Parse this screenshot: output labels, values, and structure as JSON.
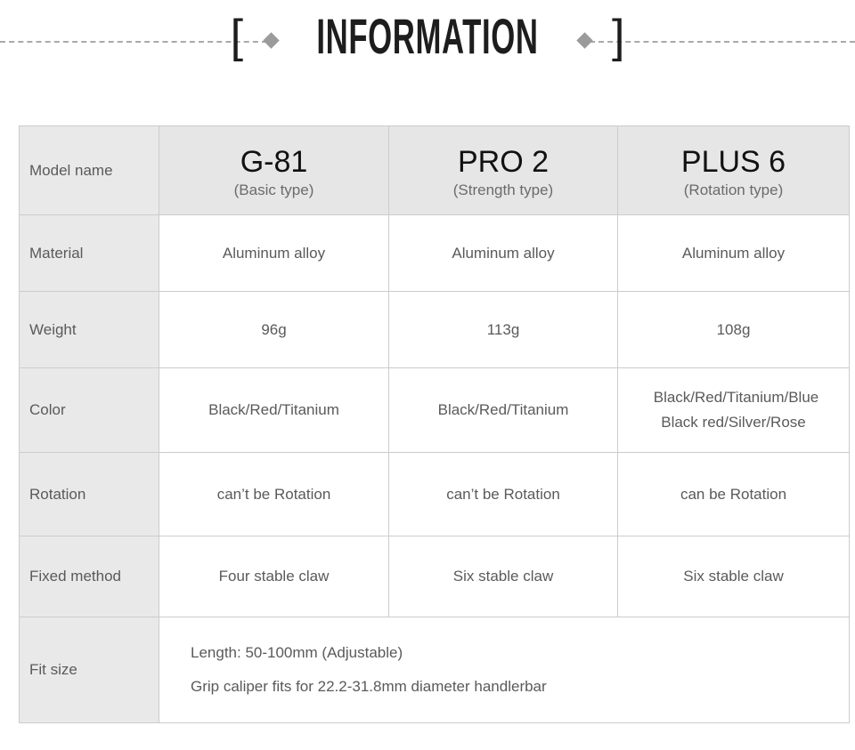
{
  "banner": {
    "bracket_left": "[",
    "title": "INFORMATION",
    "bracket_right": "]",
    "accent_color": "#9b9b9b",
    "rule_color": "#a9a9a9",
    "title_color": "#1d1d1d"
  },
  "table": {
    "header_bg": "#e6e6e6",
    "label_bg": "#e9e9e9",
    "border_color": "#cccccc",
    "columns": [
      {
        "label": "Model name",
        "model": "G-81",
        "type": "(Basic type)"
      },
      {
        "label": "Model name",
        "model": "PRO 2",
        "type": "(Strength type)"
      },
      {
        "label": "Model name",
        "model": "PLUS 6",
        "type": "(Rotation type)"
      }
    ],
    "header_label": "Model name",
    "rows": [
      {
        "label": "Material",
        "values": [
          "Aluminum alloy",
          "Aluminum alloy",
          "Aluminum alloy"
        ]
      },
      {
        "label": "Weight",
        "values": [
          "96g",
          "113g",
          "108g"
        ]
      },
      {
        "label": "Color",
        "values": [
          "Black/Red/Titanium",
          "Black/Red/Titanium",
          ""
        ],
        "value_c_line1": "Black/Red/Titanium/Blue",
        "value_c_line2": "Black red/Silver/Rose"
      },
      {
        "label": "Rotation",
        "values": [
          "can’t be Rotation",
          "can’t be Rotation",
          "can be Rotation"
        ]
      },
      {
        "label": "Fixed method",
        "values": [
          "Four stable claw",
          "Six stable claw",
          "Six stable claw"
        ]
      }
    ],
    "fit_row": {
      "label": "Fit size",
      "line1": "Length: 50-100mm (Adjustable)",
      "line2": "Grip caliper fits for 22.2-31.8mm diameter handlerbar"
    }
  }
}
